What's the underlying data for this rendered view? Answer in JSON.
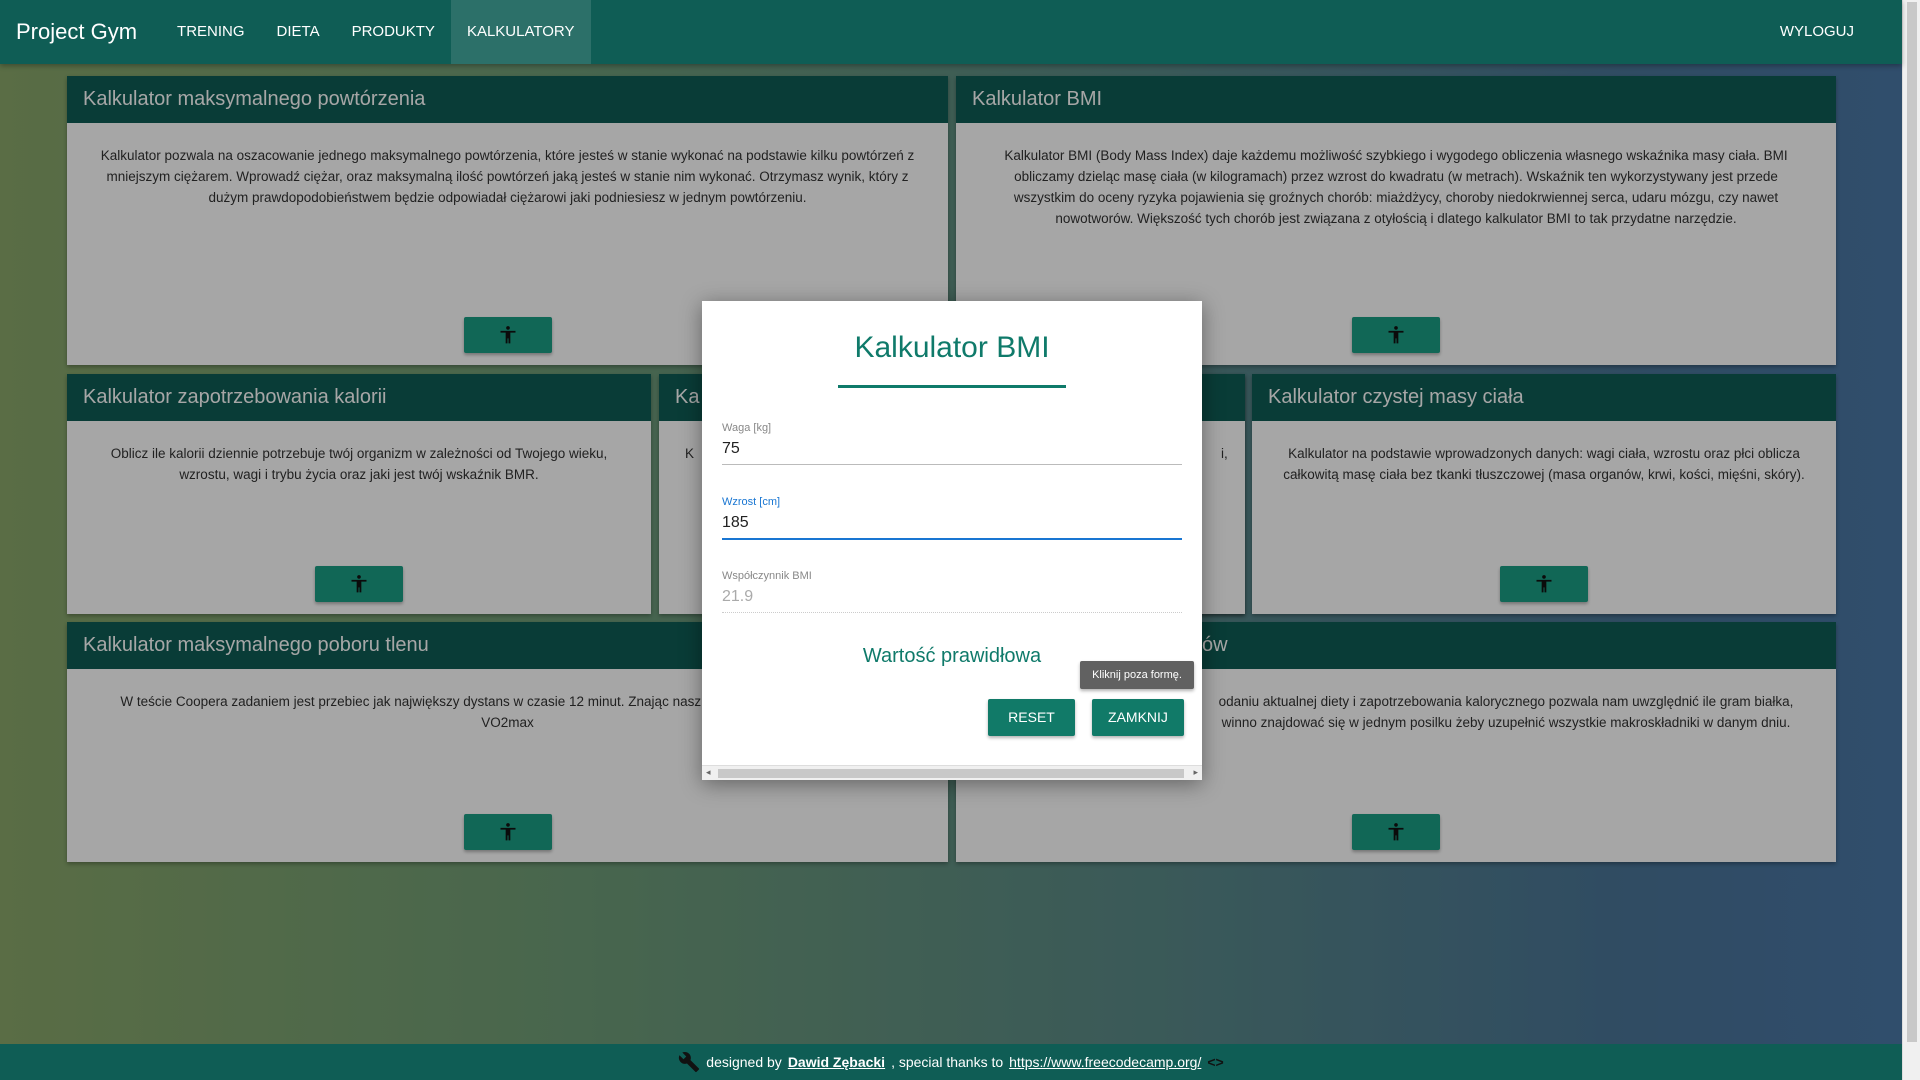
{
  "nav": {
    "brand": "Project Gym",
    "items": [
      "TRENING",
      "DIETA",
      "PRODUKTY",
      "KALKULATORY"
    ],
    "active": "KALKULATORY",
    "logout": "WYLOGUJ"
  },
  "cards": [
    {
      "title": "Kalkulator maksymalnego powtórzenia",
      "text": "Kalkulator pozwala na oszacowanie jednego maksymalnego powtórzenia, które jesteś w stanie wykonać na podstawie kilku powtórzeń z mniejszym ciężarem. Wprowadź ciężar, oraz maksymalną ilość powtórzeń jaką jesteś w stanie nim wykonać. Otrzymasz wynik, który z dużym prawdopodobieństwem będzie odpowiadał ciężarowi jaki podniesiesz w jednym powtórzeniu."
    },
    {
      "title": "Kalkulator BMI",
      "text": "Kalkulator BMI (Body Mass Index) daje każdemu możliwość szybkiego i wygodego obliczenia własnego wskaźnika masy ciała. BMI obliczamy dzieląc masę ciała (w kilogramach) przez wzrost do kwadratu (w metrach). Wskaźnik ten wykorzystywany jest przede wszystkim do oceny ryzyka pojawienia się groźnych chorób: miażdżycy, choroby niedokrwiennej serca, udaru mózgu, czy nawet nowotworów. Większość tych chorób jest związana z otyłością i dlatego kalkulator BMI to tak przydatne narzędzie."
    },
    {
      "title": "Kalkulator zapotrzebowania kalorii",
      "text": "Oblicz ile kalorii dziennie potrzebuje twój organizm w zależności od Twojego wieku, wzrostu, wagi i trybu życia oraz jaki jest twój wskaźnik BMR."
    },
    {
      "title": "Ka",
      "text": "K"
    },
    {
      "title": "",
      "text": "i,"
    },
    {
      "title": "Kalkulator czystej masy ciała",
      "text": "Kalkulator na podstawie wprowadzonych danych: wagi ciała, wzrostu oraz płci oblicza całkowitą masę ciała bez tkanki tłuszczowej (masa organów, krwi, kości, mięśni, skóry)."
    },
    {
      "title": "Kalkulator maksymalnego poboru tlenu",
      "text": "W teście Coopera zadaniem jest przebiec jak największy dystans w czasie 12 minut. Znając nasz w obliczyć w przybliżeniu nasze VO2max"
    },
    {
      "title": "ów",
      "text": "odaniu aktualnej diety i zapotrzebowania kalorycznego pozwala nam uwzględnić ile gram białka, winno znajdować się w jednym posilku żeby uzupełnić wszystkie makroskładniki w danym dniu."
    }
  ],
  "modal": {
    "title": "Kalkulator BMI",
    "weight_label": "Waga [kg]",
    "weight_value": "75",
    "height_label": "Wzrost [cm]",
    "height_value": "185",
    "bmi_label": "Współczynnik BMI",
    "bmi_value": "21.9",
    "result": "Wartość prawidłowa",
    "reset": "RESET",
    "close": "ZAMKNIJ"
  },
  "tooltip": "Kliknij poza formę.",
  "footer": {
    "designed_by": "designed by",
    "author": "Dawid Zębacki",
    "thanks": ", special thanks to",
    "link": "https://www.freecodecamp.org/"
  }
}
